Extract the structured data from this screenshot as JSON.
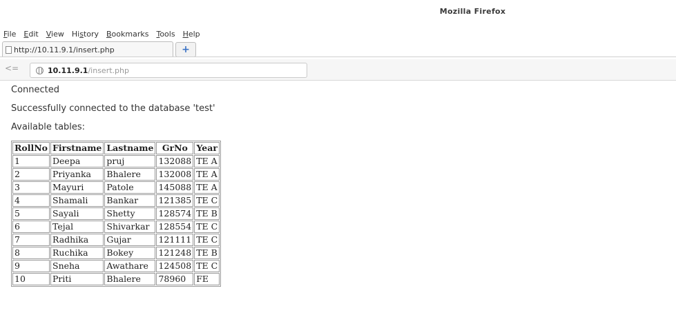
{
  "window": {
    "title": "Mozilla Firefox"
  },
  "menubar": {
    "items": [
      {
        "label": "File",
        "accel": "F",
        "rest": "ile"
      },
      {
        "label": "Edit",
        "accel": "E",
        "rest": "dit"
      },
      {
        "label": "View",
        "accel": "V",
        "rest": "iew"
      },
      {
        "label": "History",
        "pre": "Hi",
        "accel": "s",
        "rest": "tory"
      },
      {
        "label": "Bookmarks",
        "accel": "B",
        "rest": "ookmarks"
      },
      {
        "label": "Tools",
        "accel": "T",
        "rest": "ools"
      },
      {
        "label": "Help",
        "accel": "H",
        "rest": "elp"
      }
    ]
  },
  "tab": {
    "title": "http://10.11.9.1/insert.php",
    "newtab_symbol": "+"
  },
  "navbar": {
    "back_symbol": "<=",
    "url_host": "10.11.9.1",
    "url_path": "/insert.php"
  },
  "page": {
    "line1": "Connected",
    "line2": "Successfully connected to the database 'test'",
    "line3": "Available tables:",
    "table": {
      "headers": [
        "RollNo",
        "Firstname",
        "Lastname",
        "GrNo",
        "Year"
      ],
      "rows": [
        [
          "1",
          "Deepa",
          "pruj",
          "132088",
          "TE A"
        ],
        [
          "2",
          "Priyanka",
          "Bhalere",
          "132008",
          "TE A"
        ],
        [
          "3",
          "Mayuri",
          "Patole",
          "145088",
          "TE A"
        ],
        [
          "4",
          "Shamali",
          "Bankar",
          "121385",
          "TE C"
        ],
        [
          "5",
          "Sayali",
          "Shetty",
          "128574",
          "TE B"
        ],
        [
          "6",
          "Tejal",
          "Shivarkar",
          "128554",
          "TE C"
        ],
        [
          "7",
          "Radhika",
          "Gujar",
          "121111",
          "TE C"
        ],
        [
          "8",
          "Ruchika",
          "Bokey",
          "121248",
          "TE B"
        ],
        [
          "9",
          "Sneha",
          "Awathare",
          "124508",
          "TE C"
        ],
        [
          "10",
          "Priti",
          "Bhalere",
          "78960",
          "FE"
        ]
      ]
    }
  }
}
